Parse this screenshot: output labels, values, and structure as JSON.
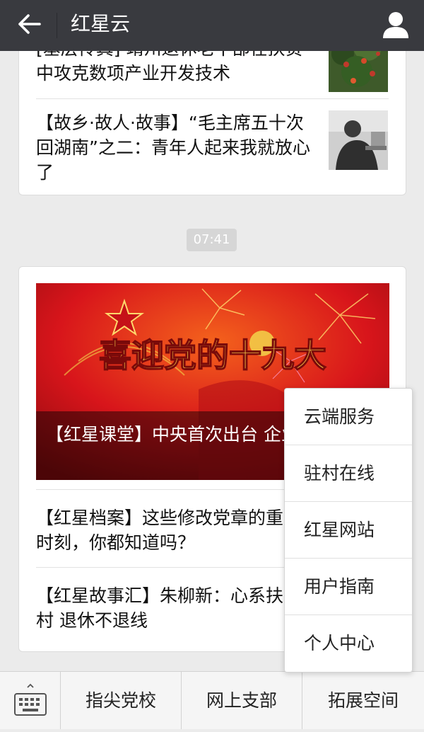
{
  "header": {
    "title": "红星云"
  },
  "card1": {
    "items": [
      {
        "text": "[基层传真] 靖州退休老干部在扶贫中攻克数项产业开发技术"
      },
      {
        "text": "【故乡·故人·故事】“毛主席五十次回湖南”之二：青年人起来我就放心了"
      }
    ]
  },
  "timestamp": "07:41",
  "card2": {
    "banner_caption": "【红星课堂】中央首次出台 企业家精神",
    "banner_artwork_text": "喜迎党的十九大",
    "items": [
      {
        "text": "【红星档案】这些修改党章的重 大时刻，你都知道吗？"
      },
      {
        "text": "【红星故事汇】朱柳新：心系扶 贫村 退休不退线"
      }
    ]
  },
  "menu": {
    "items": [
      {
        "label": "云端服务"
      },
      {
        "label": "驻村在线"
      },
      {
        "label": "红星网站"
      },
      {
        "label": "用户指南"
      },
      {
        "label": "个人中心"
      }
    ]
  },
  "bottom": {
    "tabs": [
      {
        "label": "指尖党校"
      },
      {
        "label": "网上支部"
      },
      {
        "label": "拓展空间"
      }
    ]
  },
  "colors": {
    "topbar": "#393a3f",
    "banner_red": "#d8151b",
    "gold": "#f3d34a"
  }
}
